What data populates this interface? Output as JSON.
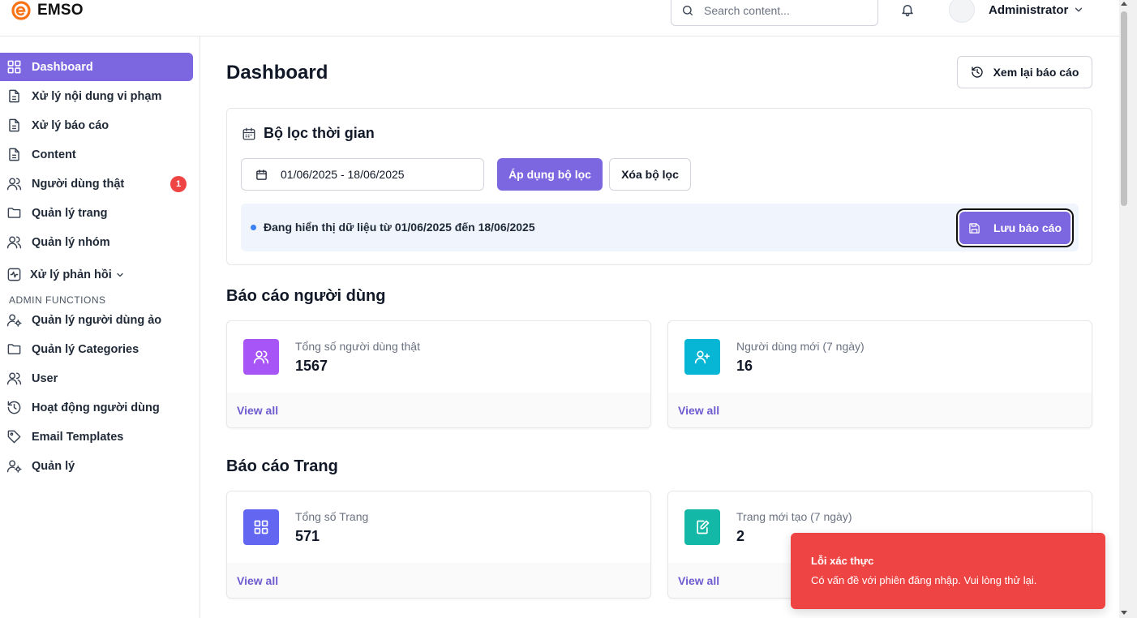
{
  "app": {
    "name": "EMSO",
    "brand_color": "#f97316"
  },
  "header": {
    "search_placeholder": "Search content...",
    "user_name": "Administrator"
  },
  "sidebar": {
    "items": [
      {
        "label": "Dashboard",
        "icon": "grid-icon",
        "active": true
      },
      {
        "label": "Xử lý nội dung vi phạm",
        "icon": "document-icon"
      },
      {
        "label": "Xử lý báo cáo",
        "icon": "document-icon"
      },
      {
        "label": "Content",
        "icon": "document-icon"
      },
      {
        "label": "Người dùng thật",
        "icon": "users-icon",
        "badge": "1"
      },
      {
        "label": "Quản lý trang",
        "icon": "folder-icon"
      },
      {
        "label": "Quản lý nhóm",
        "icon": "users-icon"
      },
      {
        "label": "Xử lý phản hồi",
        "icon": "activity-icon"
      }
    ],
    "admin_section_label": "ADMIN FUNCTIONS",
    "admin_items": [
      {
        "label": "Quản lý người dùng ảo",
        "icon": "user-cog-icon"
      },
      {
        "label": "Quản lý Categories",
        "icon": "folder-icon"
      },
      {
        "label": "User",
        "icon": "users-icon"
      },
      {
        "label": "Hoạt động người dùng",
        "icon": "history-icon"
      },
      {
        "label": "Email Templates",
        "icon": "tag-icon"
      },
      {
        "label": "Quản lý",
        "icon": "user-cog-icon"
      }
    ],
    "accent_color": "#7c67e0"
  },
  "main": {
    "title": "Dashboard",
    "history_button": "Xem lại báo cáo",
    "filter": {
      "title": "Bộ lọc thời gian",
      "date_range": "01/06/2025 - 18/06/2025",
      "apply_label": "Áp dụng bộ lọc",
      "clear_label": "Xóa bộ lọc",
      "info_text": "Đang hiển thị dữ liệu từ 01/06/2025 đến 18/06/2025",
      "save_label": "Lưu báo cáo"
    },
    "user_report": {
      "title": "Báo cáo người dùng",
      "cards": [
        {
          "label": "Tổng số người dùng thật",
          "value": "1567",
          "link": "View all",
          "icon": "users-icon",
          "color": "#a855f7"
        },
        {
          "label": "Người dùng mới (7 ngày)",
          "value": "16",
          "link": "View all",
          "icon": "user-plus-icon",
          "color": "#06b6d4"
        }
      ]
    },
    "page_report": {
      "title": "Báo cáo Trang",
      "cards": [
        {
          "label": "Tổng số Trang",
          "value": "571",
          "link": "View all",
          "icon": "grid-icon",
          "color": "#6366f1"
        },
        {
          "label": "Trang mới tạo (7 ngày)",
          "value": "2",
          "link": "View all",
          "icon": "edit-icon",
          "color": "#14b8a6"
        }
      ]
    }
  },
  "toast": {
    "title": "Lỗi xác thực",
    "message": "Có vấn đề với phiên đăng nhập. Vui lòng thử lại.",
    "color": "#ef4444"
  }
}
